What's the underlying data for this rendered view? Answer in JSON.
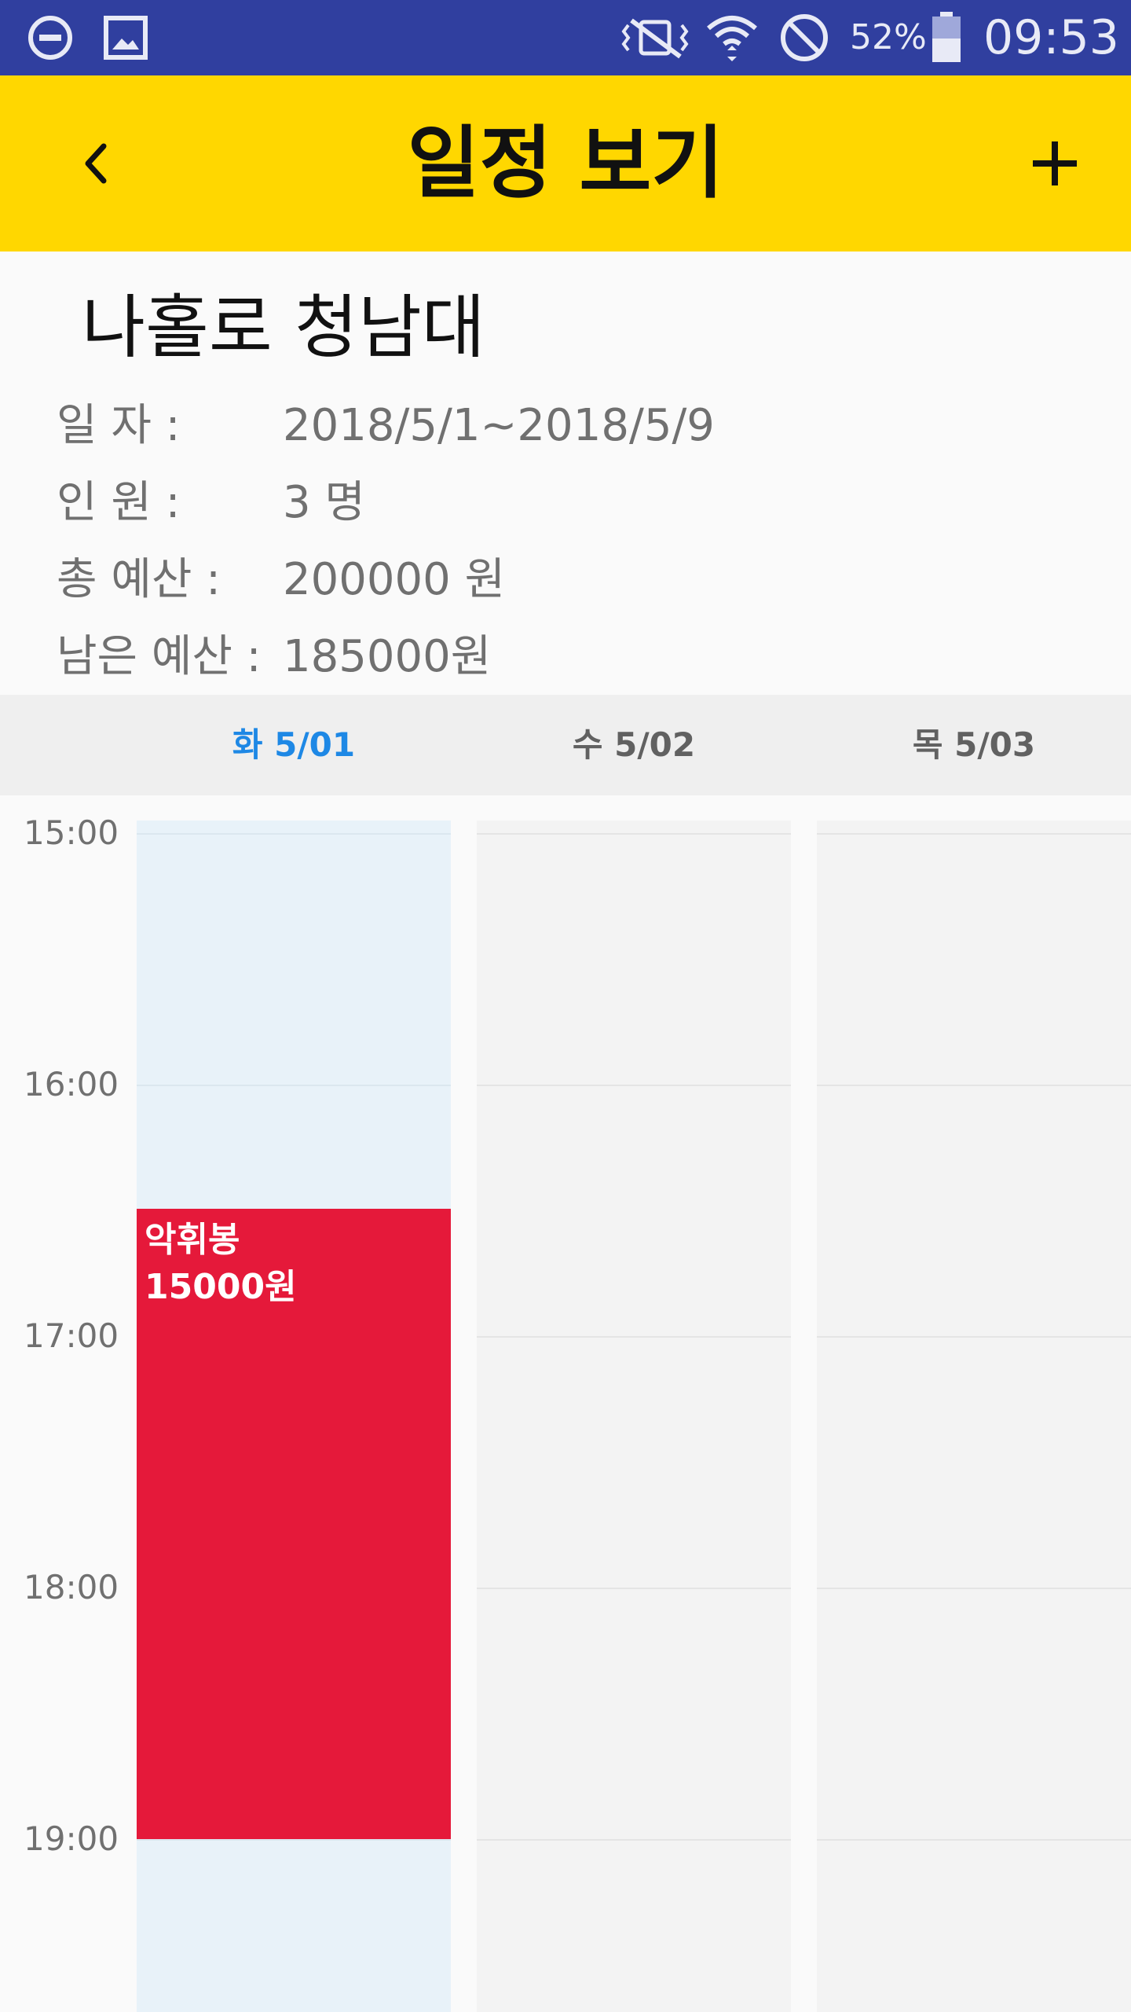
{
  "status_bar": {
    "battery": "52%",
    "time": "09:53"
  },
  "toolbar": {
    "title": "일정 보기",
    "back_icon": "chevron-left-icon",
    "add_icon": "plus-icon"
  },
  "trip": {
    "name": "나홀로 청남대",
    "info": [
      {
        "label": "일 자 :",
        "value": "2018/5/1~2018/5/9"
      },
      {
        "label": "인 원 :",
        "value": "3 명"
      },
      {
        "label": "총 예산 :",
        "value": "200000 원"
      },
      {
        "label": "남은 예산 :",
        "value": "185000원"
      }
    ]
  },
  "schedule": {
    "days": [
      {
        "label": "화 5/01",
        "active": true
      },
      {
        "label": "수 5/02",
        "active": false
      },
      {
        "label": "목 5/03",
        "active": false
      }
    ],
    "hours": [
      "15:00",
      "16:00",
      "17:00",
      "18:00",
      "19:00"
    ],
    "events": [
      {
        "name": "악휘봉",
        "cost": "15000원",
        "day": "화 5/01",
        "start": "16:30",
        "end": "19:00",
        "color": "#e5193a"
      }
    ]
  },
  "colors": {
    "status_bar": "#303f9f",
    "toolbar": "#ffd700",
    "active_day": "#1e88e5",
    "event": "#e5193a"
  }
}
